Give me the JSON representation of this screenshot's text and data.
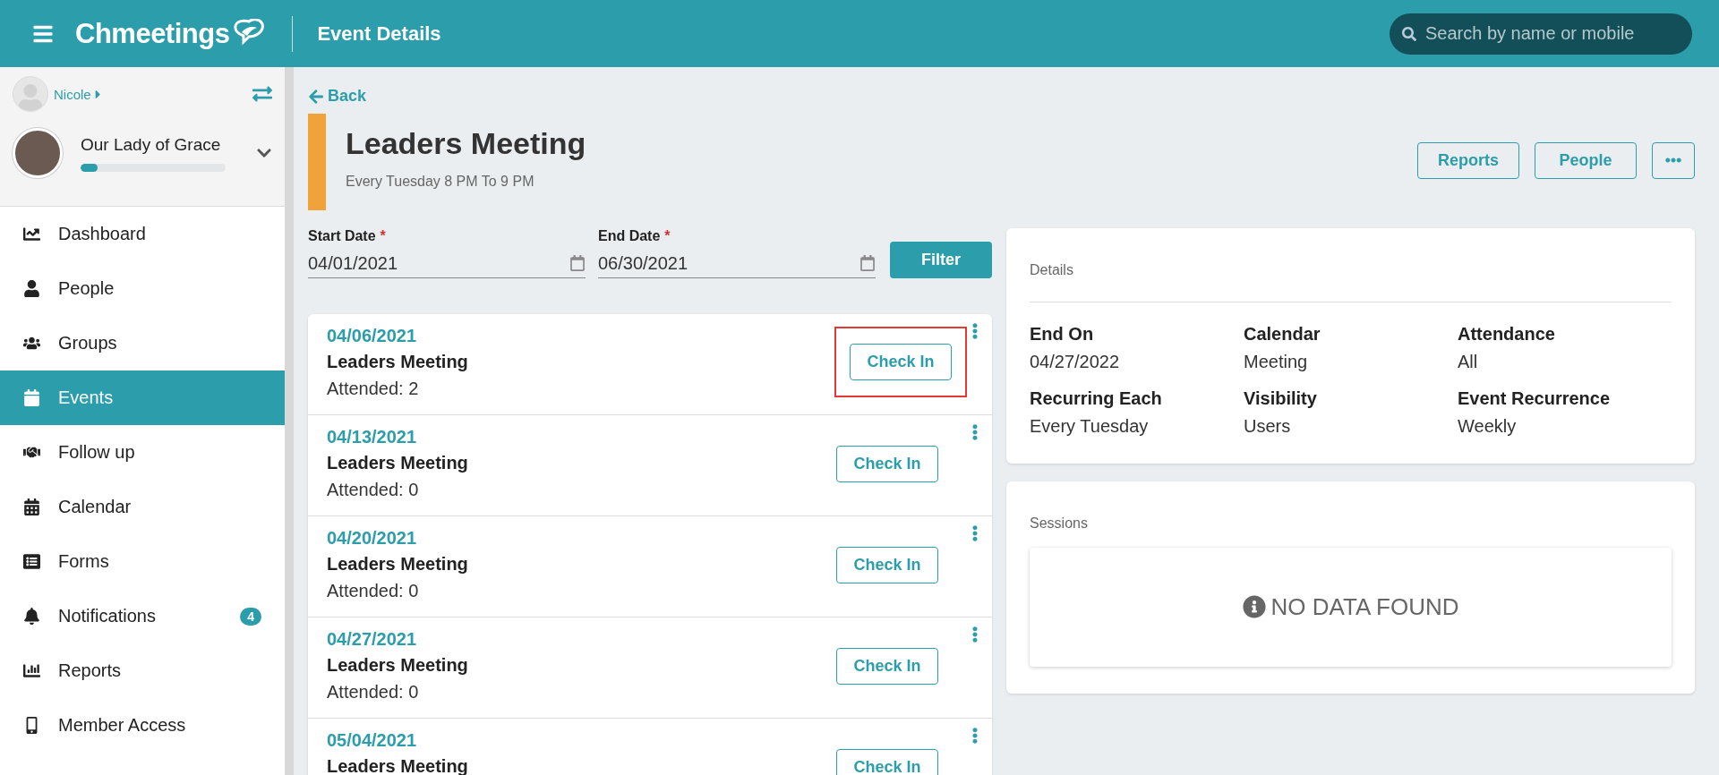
{
  "header": {
    "brand": "Chmeetings",
    "title": "Event Details",
    "search": {
      "placeholder": "Search by name or mobile"
    }
  },
  "sidebar": {
    "user": "Nicole",
    "church": {
      "name": "Our Lady of Grace",
      "level": 0.12
    },
    "items": [
      {
        "label": "Dashboard",
        "selected": false
      },
      {
        "label": "People",
        "selected": false
      },
      {
        "label": "Groups",
        "selected": false
      },
      {
        "label": "Events",
        "selected": true
      },
      {
        "label": "Follow up",
        "selected": false
      },
      {
        "label": "Calendar",
        "selected": false
      },
      {
        "label": "Forms",
        "selected": false
      },
      {
        "label": "Notifications",
        "selected": false,
        "badge": "4"
      },
      {
        "label": "Reports",
        "selected": false
      },
      {
        "label": "Member Access",
        "selected": false
      }
    ]
  },
  "back": "Back",
  "event": {
    "title": "Leaders Meeting",
    "schedule": "Every Tuesday 8 PM To 9 PM",
    "color": "#f0a33a"
  },
  "actions": [
    "Reports",
    "People"
  ],
  "filter": {
    "start": {
      "label": "Start Date",
      "required_mark": "*",
      "value": "04/01/2021"
    },
    "end": {
      "label": "End Date",
      "required_mark": "*",
      "value": "06/30/2021"
    },
    "button": "Filter"
  },
  "occurrences": [
    {
      "date": "04/06/2021",
      "name": "Leaders Meeting",
      "attended": "Attended: 2",
      "button": "Check In",
      "highlighted": true
    },
    {
      "date": "04/13/2021",
      "name": "Leaders Meeting",
      "attended": "Attended: 0",
      "button": "Check In",
      "highlighted": false
    },
    {
      "date": "04/20/2021",
      "name": "Leaders Meeting",
      "attended": "Attended: 0",
      "button": "Check In",
      "highlighted": false
    },
    {
      "date": "04/27/2021",
      "name": "Leaders Meeting",
      "attended": "Attended: 0",
      "button": "Check In",
      "highlighted": false
    },
    {
      "date": "05/04/2021",
      "name": "Leaders Meeting",
      "button": "Check In",
      "highlighted": false
    }
  ],
  "details": {
    "title": "Details",
    "fields": [
      {
        "label": "End On",
        "value": "04/27/2022"
      },
      {
        "label": "Calendar",
        "value": "Meeting"
      },
      {
        "label": "Attendance",
        "value": "All"
      },
      {
        "label": "Recurring Each",
        "value": "Every Tuesday"
      },
      {
        "label": "Visibility",
        "value": "Users"
      },
      {
        "label": "Event Recurrence",
        "value": "Weekly"
      }
    ]
  },
  "sessions": {
    "title": "Sessions",
    "empty": "NO DATA FOUND"
  }
}
